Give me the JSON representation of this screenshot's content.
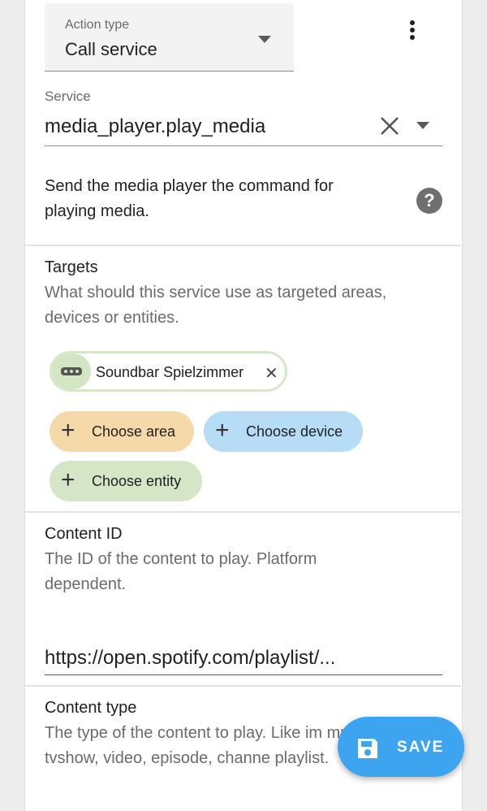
{
  "action_type": {
    "label": "Action type",
    "value": "Call service"
  },
  "service": {
    "label": "Service",
    "value": "media_player.play_media"
  },
  "service_description": "Send the media player the command for playing media.",
  "targets": {
    "title": "Targets",
    "description": "What should this service use as targeted areas, devices or entities.",
    "selected_chip": {
      "label": "Soundbar Spielzimmer",
      "icon": "soundbar-icon"
    },
    "choose_area": "Choose area",
    "choose_device": "Choose device",
    "choose_entity": "Choose entity"
  },
  "content_id": {
    "title": "Content ID",
    "description": "The ID of the content to play. Platform dependent.",
    "value": "https://open.spotify.com/playlist/..."
  },
  "content_type": {
    "title": "Content type",
    "description": "The type of the content to play. Like im music, tvshow, video, episode, channe playlist."
  },
  "save_button": {
    "label": "SAVE"
  },
  "colors": {
    "area": "#f6d9a9",
    "device": "#b6dcf6",
    "entity": "#d4e6c6",
    "fab": "#3da5ef"
  }
}
